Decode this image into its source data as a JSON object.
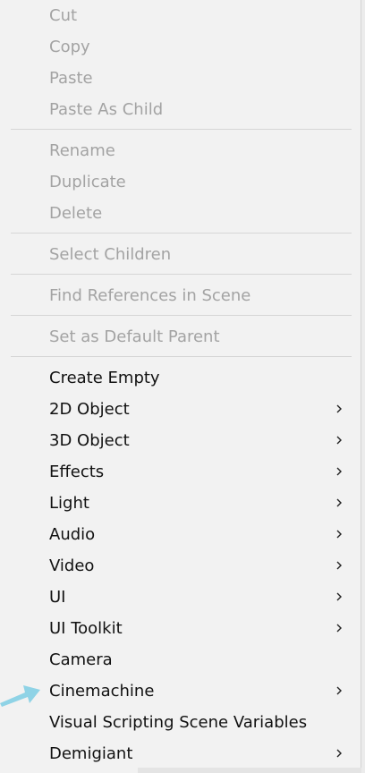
{
  "menu": {
    "items": [
      {
        "label": "Cut",
        "state": "disabled",
        "submenu": false
      },
      {
        "label": "Copy",
        "state": "disabled",
        "submenu": false
      },
      {
        "label": "Paste",
        "state": "disabled",
        "submenu": false
      },
      {
        "label": "Paste As Child",
        "state": "disabled",
        "submenu": false
      },
      {
        "label": "Rename",
        "state": "disabled",
        "submenu": false
      },
      {
        "label": "Duplicate",
        "state": "disabled",
        "submenu": false
      },
      {
        "label": "Delete",
        "state": "disabled",
        "submenu": false
      },
      {
        "label": "Select Children",
        "state": "disabled",
        "submenu": false
      },
      {
        "label": "Find References in Scene",
        "state": "disabled",
        "submenu": false
      },
      {
        "label": "Set as Default Parent",
        "state": "disabled",
        "submenu": false
      },
      {
        "label": "Create Empty",
        "state": "enabled",
        "submenu": false
      },
      {
        "label": "2D Object",
        "state": "enabled",
        "submenu": true
      },
      {
        "label": "3D Object",
        "state": "enabled",
        "submenu": true
      },
      {
        "label": "Effects",
        "state": "enabled",
        "submenu": true
      },
      {
        "label": "Light",
        "state": "enabled",
        "submenu": true
      },
      {
        "label": "Audio",
        "state": "enabled",
        "submenu": true
      },
      {
        "label": "Video",
        "state": "enabled",
        "submenu": true
      },
      {
        "label": "UI",
        "state": "enabled",
        "submenu": true
      },
      {
        "label": "UI Toolkit",
        "state": "enabled",
        "submenu": true
      },
      {
        "label": "Camera",
        "state": "enabled",
        "submenu": false
      },
      {
        "label": "Cinemachine",
        "state": "enabled",
        "submenu": true
      },
      {
        "label": "Visual Scripting Scene Variables",
        "state": "enabled",
        "submenu": false
      },
      {
        "label": "Demigiant",
        "state": "enabled",
        "submenu": true
      }
    ]
  },
  "colors": {
    "menu_bg": "#f2f2f2",
    "enabled_text": "#111111",
    "disabled_text": "#a3a3a3",
    "separator": "#d6d6d6",
    "pointer_arrow": "#8fd3e6"
  },
  "icons": {
    "submenu": "chevron-right-icon",
    "pointer": "pointer-arrow-icon"
  }
}
